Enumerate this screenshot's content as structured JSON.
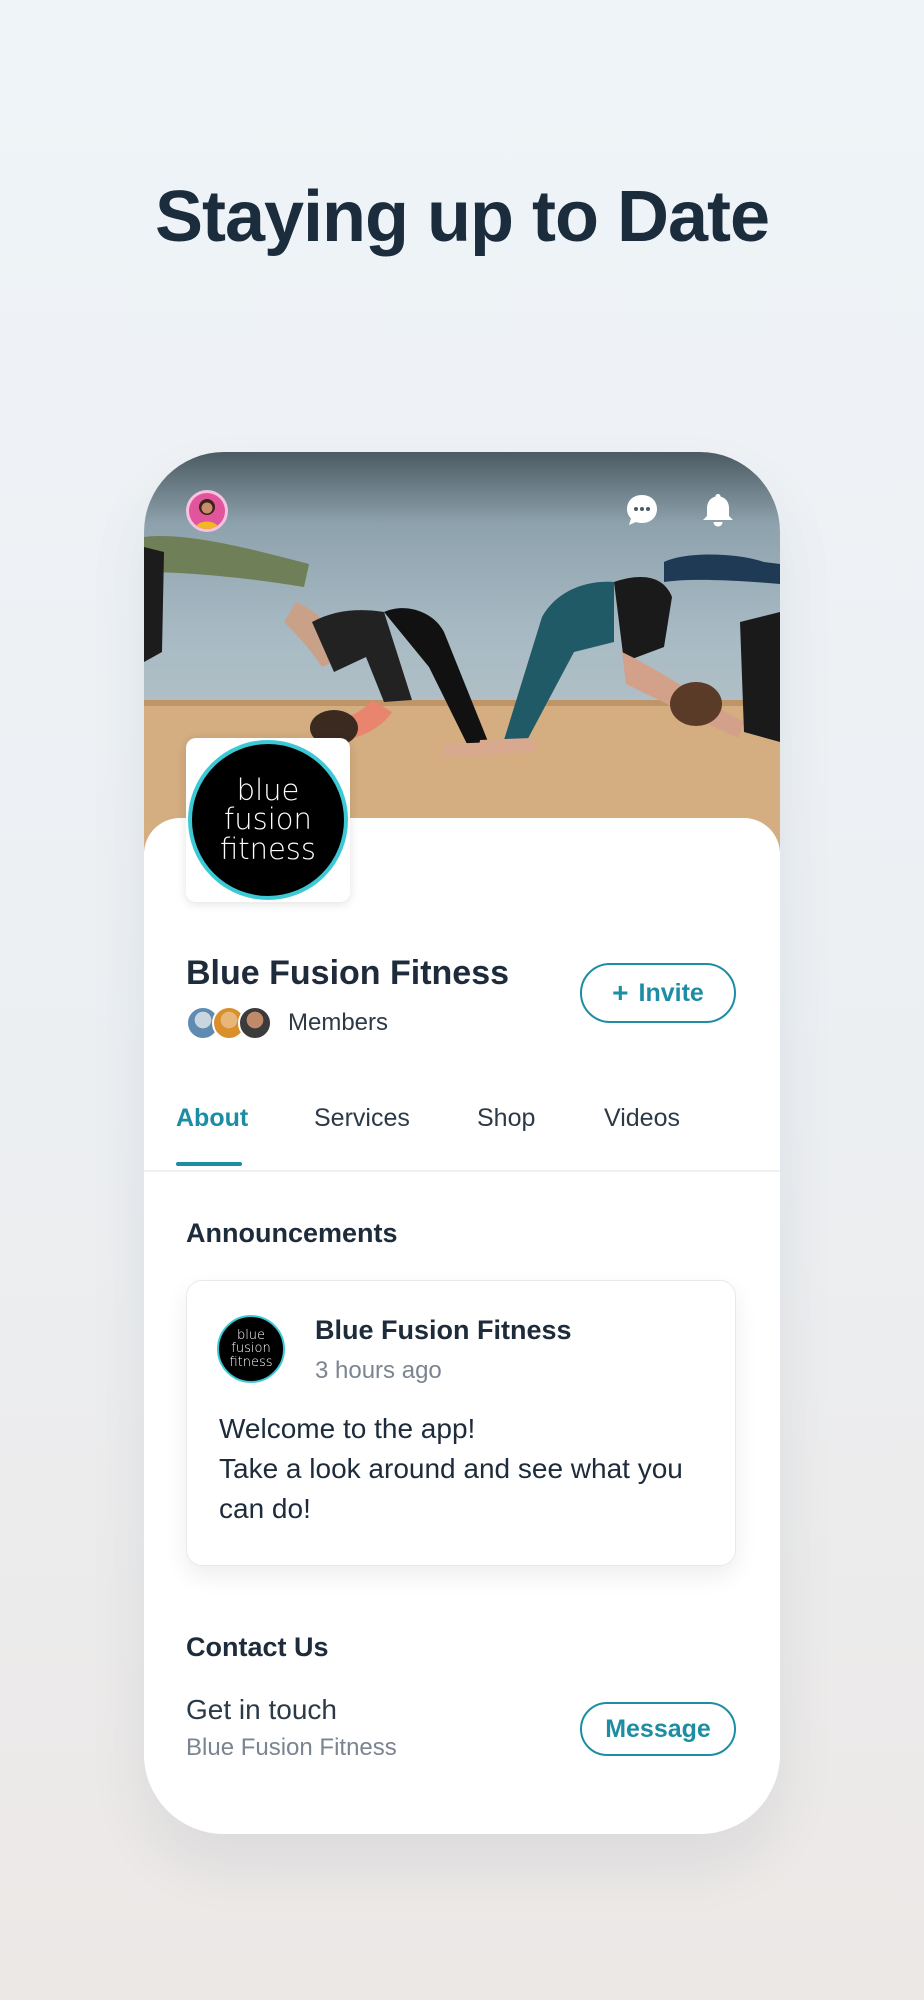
{
  "headline": "Staying up to Date",
  "topbar": {
    "avatar_icon": "user-avatar",
    "chat_icon": "chat-bubble-icon",
    "bell_icon": "bell-icon"
  },
  "group": {
    "logo_lines": [
      "blue",
      "fusion",
      "fitness"
    ],
    "name": "Blue Fusion Fitness",
    "members_label": "Members",
    "invite_plus": "+",
    "invite_label": "Invite"
  },
  "tabs": [
    {
      "label": "About",
      "active": true
    },
    {
      "label": "Services",
      "active": false
    },
    {
      "label": "Shop",
      "active": false
    },
    {
      "label": "Videos",
      "active": false
    }
  ],
  "announcements": {
    "title": "Announcements",
    "post": {
      "author": "Blue Fusion Fitness",
      "time": "3 hours ago",
      "body_line1": "Welcome to the app!",
      "body_line2": "Take a look around and see what you can do!"
    }
  },
  "contact": {
    "title": "Contact Us",
    "subtitle": "Get in touch",
    "name": "Blue Fusion Fitness",
    "message_label": "Message"
  },
  "colors": {
    "accent": "#1c8da3",
    "logo_ring": "#3cc9d6",
    "text_dark": "#1d2b3a",
    "text_muted": "#7a8591"
  }
}
